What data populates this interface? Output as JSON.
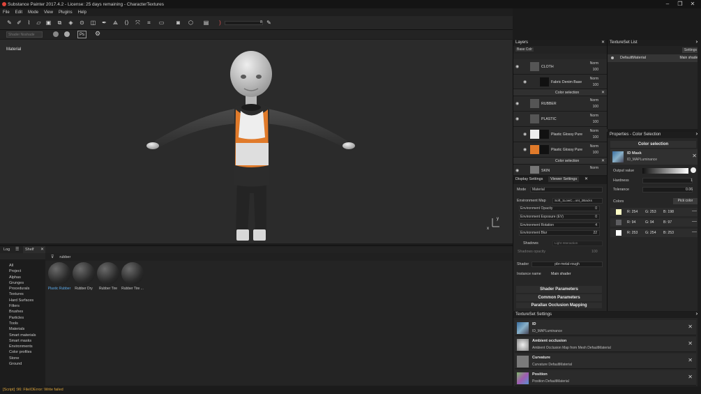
{
  "window": {
    "title": "Substance Painter 2017.4.2 - License: 25 days remaining - CharacterTextures"
  },
  "menu": [
    "File",
    "Edit",
    "Mode",
    "View",
    "Plugins",
    "Help"
  ],
  "toolbar": {
    "zoom_value": "8"
  },
  "toolbar2": {
    "field": "Shader Noshade",
    "ps_label": "Ps"
  },
  "viewport": {
    "label": "Material"
  },
  "shelf": {
    "tabs": [
      "Log",
      "Shelf"
    ],
    "filter": "rubber",
    "categories": [
      "All",
      "Project",
      "Alphas",
      "Grunges",
      "Procedurals",
      "Textures",
      "Hard Surfaces",
      "Filters",
      "Brushes",
      "Particles",
      "Tools",
      "Materials",
      "Smart materials",
      "Smart masks",
      "Environments",
      "Color profiles",
      "Stone",
      "Ground"
    ],
    "materials": [
      "Plastic Rubber",
      "Rubber Dry",
      "Rubber Tire",
      "Rubber Tire ..."
    ]
  },
  "status": {
    "message": "[Script] :96: FileIOError: Write failed"
  },
  "layers": {
    "title": "Layers",
    "channel": "Base Colr",
    "rows": [
      {
        "name": "CLOTH",
        "blend": "Norm",
        "opacity": "100"
      },
      {
        "name": "Fabric Denim Base",
        "blend": "Norm",
        "opacity": "100"
      },
      {
        "name": "Color selection",
        "blend": "",
        "opacity": ""
      },
      {
        "name": "RUBBER",
        "blend": "Norm",
        "opacity": "100"
      },
      {
        "name": "PLASTIC",
        "blend": "Norm",
        "opacity": "100"
      },
      {
        "name": "Plastic Glossy Pure",
        "blend": "Norm",
        "opacity": "100"
      },
      {
        "name": "Plastic Glossy Pure",
        "blend": "Norm",
        "opacity": "100"
      },
      {
        "name": "Color selection",
        "blend": "",
        "opacity": ""
      },
      {
        "name": "SKIN",
        "blend": "Norm",
        "opacity": ""
      }
    ]
  },
  "textureset_list": {
    "title": "TextureSet List",
    "settings_label": "Settings",
    "material": "DefaultMaterial",
    "shader": "Main shader"
  },
  "props": {
    "title": "Properties - Color Selection",
    "section": "Color selection",
    "mask_title": "ID Mask",
    "mask_sub": "ID_MAPLuminance",
    "output_label": "Output value",
    "hardness_label": "Hardness",
    "hardness_value": "1",
    "tolerance_label": "Tolerance",
    "tolerance_value": "0.06",
    "colors_label": "Colors",
    "pick_label": "Pick color",
    "colors": [
      {
        "r": "R: 254",
        "g": "G: 253",
        "b": "B: 198",
        "hex": "#fefdc6"
      },
      {
        "r": "R: 94",
        "g": "G: 94",
        "b": "B: 97",
        "hex": "#5e5e61"
      },
      {
        "r": "R: 253",
        "g": "G: 254",
        "b": "B: 253",
        "hex": "#fdfefd"
      }
    ]
  },
  "viewer": {
    "tabs": [
      "Display Settings",
      "Viewer Settings"
    ],
    "mode_label": "Mode",
    "mode_value": "Material",
    "env_map_label": "Environment Map",
    "env_map_value": "Soft_1LowC...ont_2Backs",
    "rows": [
      {
        "label": "Environment Opacity",
        "value": "0"
      },
      {
        "label": "Environment Exposure (EV)",
        "value": "0"
      },
      {
        "label": "Environment Rotation",
        "value": "4"
      },
      {
        "label": "Environment Blur",
        "value": "22"
      }
    ],
    "shadows_label": "Shadows",
    "shadows_value": "Light Interaction",
    "shadows_opacity_label": "Shadows opacity",
    "shadows_opacity_value": "100",
    "shader_label": "Shader",
    "shader_value": "pbr-metal-rough",
    "instance_label": "Instance name",
    "instance_value": "Main shader",
    "shader_params": "Shader Parameters",
    "common_params": "Common Parameters",
    "parallax": "Parallax Occlusion Mapping"
  },
  "ts_settings": {
    "title": "TextureSet Settings",
    "rows": [
      {
        "title": "ID",
        "sub": "ID_MAPLuminance"
      },
      {
        "title": "Ambient occlusion",
        "sub": "Ambient Occlusion Map from Mesh DefaultMaterial"
      },
      {
        "title": "Curvature",
        "sub": "Curvature DefaultMaterial"
      },
      {
        "title": "Position",
        "sub": "Position DefaultMaterial"
      }
    ]
  },
  "colors": {
    "accent": "#e07a2a",
    "selection": "#3a8ad0"
  }
}
